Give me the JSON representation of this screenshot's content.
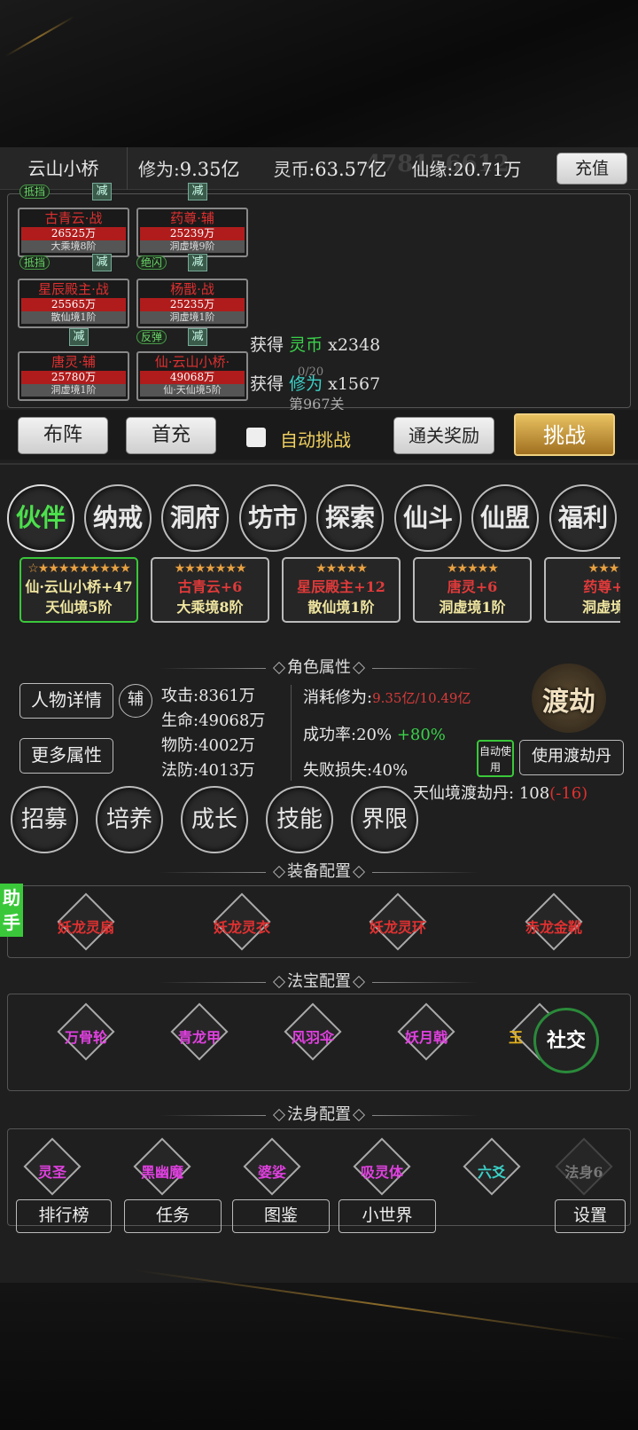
{
  "header": {
    "player_name": "云山小桥",
    "cultivation_label": "修为:",
    "cultivation_value": "9.35亿",
    "coin_label": "灵币:",
    "coin_value": "63.57亿",
    "fate_label": "仙缘:",
    "fate_value": "20.71万",
    "recharge": "充值",
    "watermark": "478156612"
  },
  "battle": {
    "cards": [
      {
        "name": "古青云·战",
        "hp": "26525万",
        "level": "大乘境8阶",
        "tag": "抵挡"
      },
      {
        "name": "药尊·辅",
        "hp": "25239万",
        "level": "洞虚境9阶",
        "tag": ""
      },
      {
        "name": "星辰殿主·战",
        "hp": "25565万",
        "level": "散仙境1阶",
        "tag": "抵挡"
      },
      {
        "name": "杨戬·战",
        "hp": "25235万",
        "level": "洞虚境1阶",
        "tag": "绝闪"
      },
      {
        "name": "唐灵·辅",
        "hp": "25780万",
        "level": "洞虚境1阶",
        "tag": ""
      },
      {
        "name": "仙·云山小桥·",
        "hp": "49068万",
        "level": "仙·天仙境5阶",
        "tag": "反弹"
      }
    ],
    "debuff": "减",
    "loot": [
      {
        "prefix": "获得",
        "item": "灵币",
        "qty": "x2348"
      },
      {
        "prefix": "获得",
        "item": "修为",
        "qty": "x1567"
      }
    ],
    "progress": "0/20",
    "stage": "第967关",
    "buttons": {
      "formation": "布阵",
      "first_recharge": "首充",
      "auto_label": "自动挑战",
      "clear_reward": "通关奖励",
      "challenge": "挑战"
    }
  },
  "nav": [
    "伙伴",
    "纳戒",
    "洞府",
    "坊市",
    "探索",
    "仙斗",
    "仙盟",
    "福利"
  ],
  "partners": [
    {
      "stars": "☆★★★★★★★★★",
      "name": "仙·云山小桥+47",
      "level": "天仙境5阶"
    },
    {
      "stars": "★★★★★★★",
      "name": "古青云+6",
      "level": "大乘境8阶"
    },
    {
      "stars": "★★★★★",
      "name": "星辰殿主+12",
      "level": "散仙境1阶"
    },
    {
      "stars": "★★★★★",
      "name": "唐灵+6",
      "level": "洞虚境1阶"
    },
    {
      "stars": "★★★",
      "name": "药尊+",
      "level": "洞虚境"
    }
  ],
  "attributes": {
    "title": "角色属性",
    "detail": "人物详情",
    "aux": "辅",
    "more": "更多属性",
    "attack": "攻击:8361万",
    "life": "生命:49068万",
    "pdef": "物防:4002万",
    "mdef": "法防:4013万",
    "consume_label": "消耗修为:",
    "consume_value": "9.35亿/10.49亿",
    "success_label": "成功率:20%",
    "success_bonus": "+80%",
    "fail_label": "失败损失:40%",
    "tribulation": "渡劫",
    "auto_use": "自动使用",
    "use_pill": "使用渡劫丹",
    "pill_label": "天仙境渡劫丹:",
    "pill_count": "108",
    "pill_delta": "(-16)"
  },
  "actions": [
    "招募",
    "培养",
    "成长",
    "技能",
    "界限"
  ],
  "equipment": {
    "title": "装备配置",
    "helper": "助手",
    "items": [
      "妖龙灵扇",
      "妖龙灵衣",
      "妖龙灵环",
      "赤龙金靴"
    ]
  },
  "treasure": {
    "title": "法宝配置",
    "items": [
      "万骨轮",
      "青龙甲",
      "风羽伞",
      "妖月戟",
      "玉"
    ],
    "social": "社交"
  },
  "body": {
    "title": "法身配置",
    "items": [
      "灵圣",
      "黑幽魔",
      "婆娑",
      "吸灵体",
      "六爻",
      "法身6"
    ]
  },
  "bottom": {
    "rank": "排行榜",
    "task": "任务",
    "atlas": "图鉴",
    "world": "小世界",
    "settings": "设置"
  }
}
